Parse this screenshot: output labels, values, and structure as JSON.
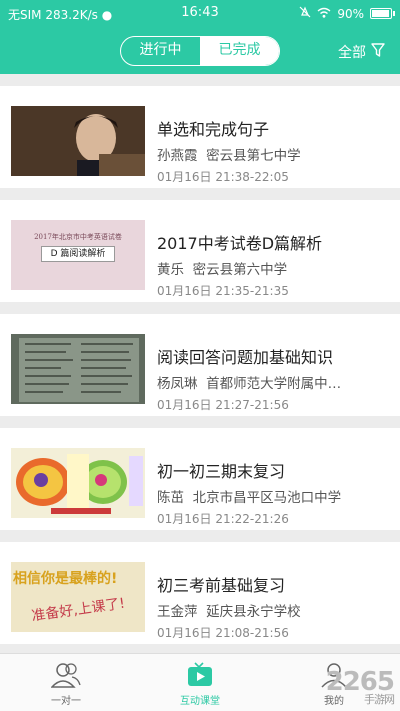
{
  "status": {
    "carrier": "无SIM",
    "speed": "283.2K/s",
    "time": "16:43",
    "battery": "90%"
  },
  "header": {
    "tabs": [
      "进行中",
      "已完成"
    ],
    "active_tab": 1,
    "filter_label": "全部",
    "accent": "#2cc9a4"
  },
  "items": [
    {
      "title": "单选和完成句子",
      "teacher": "孙燕霞",
      "school": "密云县第七中学",
      "time": "01月16日 21:38-22:05"
    },
    {
      "title": "2017中考试卷D篇解析",
      "teacher": "黄乐",
      "school": "密云县第六中学",
      "time": "01月16日 21:35-21:35",
      "thumb_text": "D 篇阅读解析",
      "thumb_header": "2017年北京市中考英语试卷"
    },
    {
      "title": "阅读回答问题加基础知识",
      "teacher": "杨凤琳",
      "school": "首都师范大学附属中…",
      "time": "01月16日 21:27-21:56"
    },
    {
      "title": "初一初三期末复习",
      "teacher": "陈茁",
      "school": "北京市昌平区马池口中学",
      "time": "01月16日 21:22-21:26"
    },
    {
      "title": "初三考前基础复习",
      "teacher": "王金萍",
      "school": "延庆县永宁学校",
      "time": "01月16日 21:08-21:56",
      "thumb_line1": "相信你是最棒的!",
      "thumb_line2": "准备好,上课了!"
    }
  ],
  "tabbar": {
    "tabs": [
      "一对一",
      "互动课堂",
      "我的"
    ],
    "active": 1
  },
  "watermark": {
    "brand": "2265",
    "sub": "手游网"
  }
}
